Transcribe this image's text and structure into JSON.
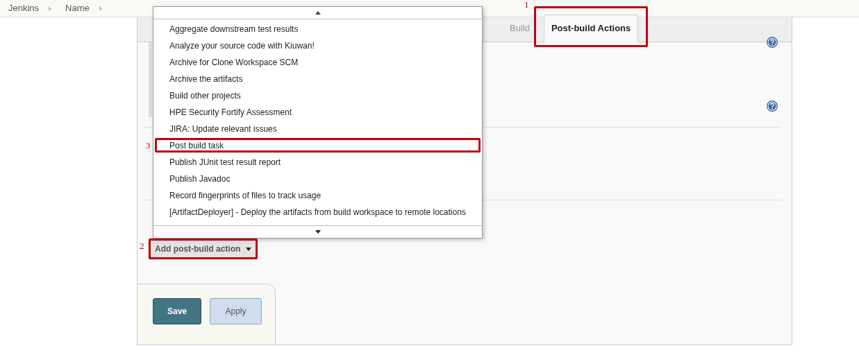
{
  "breadcrumbs": [
    {
      "label": "Jenkins"
    },
    {
      "label": "Name"
    }
  ],
  "tabs": [
    {
      "label": "Build",
      "selected": false
    },
    {
      "label": "Post-build Actions",
      "selected": true,
      "annotation": "1"
    }
  ],
  "dropdown": {
    "items": [
      {
        "label": "Aggregate downstream test results"
      },
      {
        "label": "Analyze your source code with Kiuwan!"
      },
      {
        "label": "Archive for Clone Workspace SCM"
      },
      {
        "label": "Archive the artifacts"
      },
      {
        "label": "Build other projects"
      },
      {
        "label": "HPE Security Fortify Assessment"
      },
      {
        "label": "JIRA: Update relevant issues"
      },
      {
        "label": "Post build task",
        "annotation": "3"
      },
      {
        "label": "Publish JUnit test result report"
      },
      {
        "label": "Publish Javadoc"
      },
      {
        "label": "Record fingerprints of files to track usage"
      },
      {
        "label": "[ArtifactDeployer] - Deploy the artifacts from build workspace to remote locations"
      }
    ]
  },
  "add_action_button": {
    "label": "Add post-build action",
    "annotation": "2"
  },
  "buttons": [
    {
      "label": "Save",
      "kind": "primary"
    },
    {
      "label": "Apply",
      "kind": "secondary"
    }
  ]
}
